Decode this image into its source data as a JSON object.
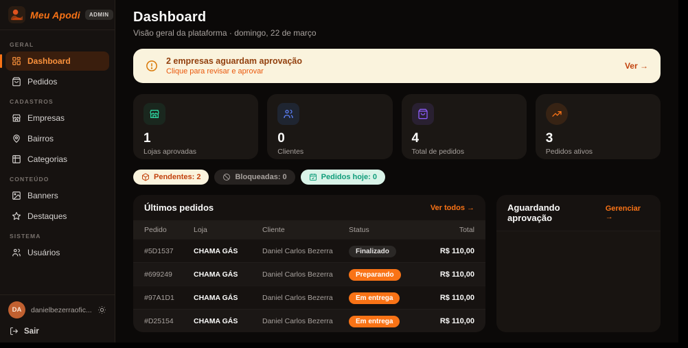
{
  "brand": {
    "name": "Meu Apodi",
    "badge": "ADMIN"
  },
  "sidebar": {
    "sections": [
      {
        "label": "Geral",
        "items": [
          {
            "label": "Dashboard"
          },
          {
            "label": "Pedidos"
          }
        ]
      },
      {
        "label": "Cadastros",
        "items": [
          {
            "label": "Empresas"
          },
          {
            "label": "Bairros"
          },
          {
            "label": "Categorias"
          }
        ]
      },
      {
        "label": "Conteúdo",
        "items": [
          {
            "label": "Banners"
          },
          {
            "label": "Destaques"
          }
        ]
      },
      {
        "label": "Sistema",
        "items": [
          {
            "label": "Usuários"
          }
        ]
      }
    ],
    "user": {
      "initials": "DA",
      "name": "danielbezerraofic...",
      "logout": "Sair"
    }
  },
  "header": {
    "title": "Dashboard",
    "subtitle": "Visão geral da plataforma · domingo, 22 de março"
  },
  "alert": {
    "title": "2 empresas aguardam aprovação",
    "subtitle": "Clique para revisar e aprovar",
    "action": "Ver →"
  },
  "stats": [
    {
      "value": "1",
      "label": "Lojas aprovadas",
      "icon": "store-icon",
      "color": "#2dd4a0"
    },
    {
      "value": "0",
      "label": "Clientes",
      "icon": "users-icon",
      "color": "#5b7ef5"
    },
    {
      "value": "4",
      "label": "Total de pedidos",
      "icon": "shopping-bag-icon",
      "color": "#8b5cf6"
    },
    {
      "value": "3",
      "label": "Pedidos ativos",
      "icon": "trending-up-icon",
      "color": "#f97316"
    }
  ],
  "chips": [
    {
      "label": "Pendentes: 2",
      "icon": "package-icon"
    },
    {
      "label": "Bloqueadas: 0",
      "icon": "ban-icon"
    },
    {
      "label": "Pedidos hoje: 0",
      "icon": "calendar-check-icon"
    }
  ],
  "orders": {
    "title": "Últimos pedidos",
    "action": "Ver todos →",
    "columns": [
      "Pedido",
      "Loja",
      "Cliente",
      "Status",
      "Total"
    ],
    "rows": [
      {
        "id": "#5D1537",
        "store": "CHAMA GÁS",
        "client": "Daniel Carlos Bezerra",
        "status": "Finalizado",
        "total": "R$ 110,00"
      },
      {
        "id": "#699249",
        "store": "CHAMA GÁS",
        "client": "Daniel Carlos Bezerra",
        "status": "Preparando",
        "total": "R$ 110,00"
      },
      {
        "id": "#97A1D1",
        "store": "CHAMA GÁS",
        "client": "Daniel Carlos Bezerra",
        "status": "Em entrega",
        "total": "R$ 110,00"
      },
      {
        "id": "#D25154",
        "store": "CHAMA GÁS",
        "client": "Daniel Carlos Bezerra",
        "status": "Em entrega",
        "total": "R$ 110,00"
      }
    ]
  },
  "approval": {
    "title": "Aguardando aprovação",
    "action": "Gerenciar →"
  },
  "colors": {
    "accent": "#f97316",
    "alert_bg": "#faf3dd",
    "status_active": "#f97316"
  }
}
